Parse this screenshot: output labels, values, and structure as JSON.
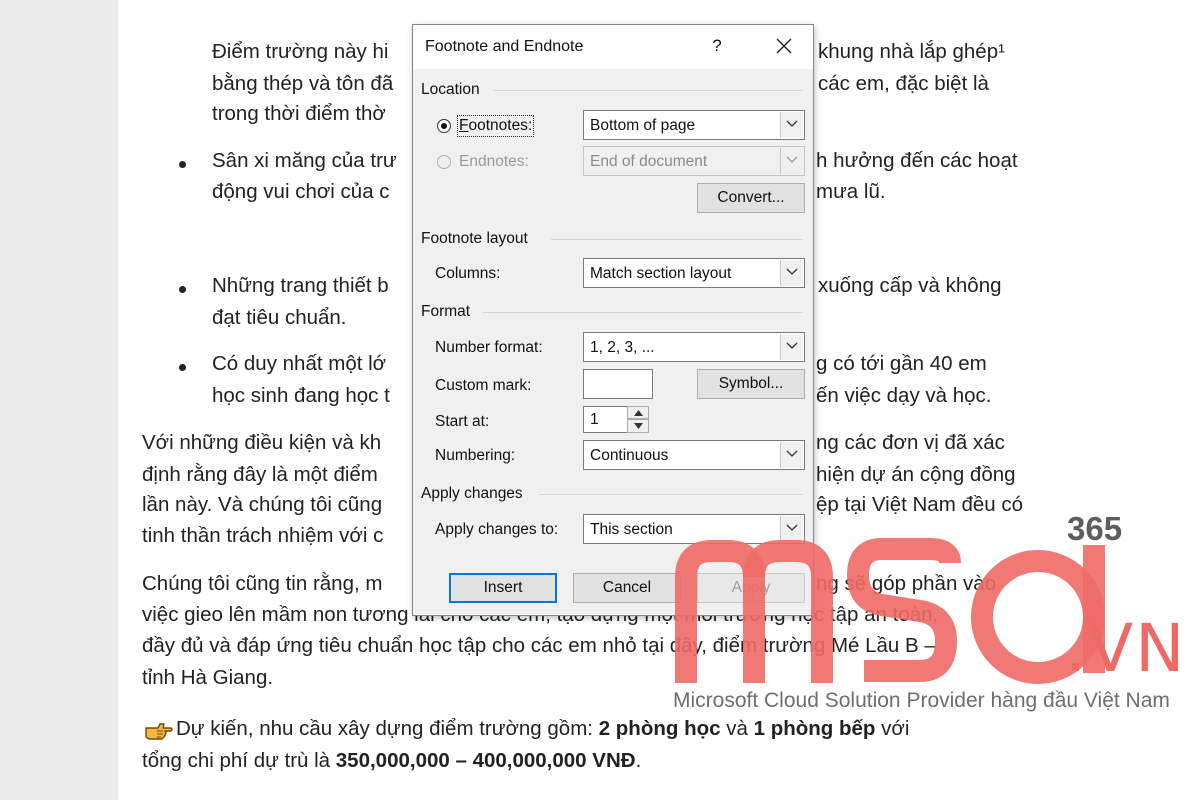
{
  "document": {
    "lines": [
      "Điểm trường này hi",
      "bằng thép và tôn đã",
      "trong thời điểm thờ",
      "Sân xi măng của trư",
      "động vui chơi của c",
      "Những trang thiết b",
      "đạt tiêu chuẩn.",
      "Có duy nhất một lớ",
      "học sinh đang học t",
      "Với những điều kiện và kh",
      "định rằng đây là một điểm",
      "lần này. Và chúng tôi cũng",
      "tinh thần trách nhiệm với c",
      "Chúng tôi cũng tin rằng, m",
      "việc gieo lên mầm non tương lai cho các em, tạo dựng một môi trường học tập an toàn,",
      "đầy đủ và đáp ứng tiêu chuẩn học tập cho các em nhỏ tại đây, điểm trường Mé Lầu B –",
      "tỉnh Hà Giang."
    ],
    "right_fragments": [
      "khung nhà lắp ghép¹",
      "các em, đặc biệt là",
      "h hưởng đến các hoạt",
      "mưa lũ.",
      "xuống cấp và không",
      "g có tới gần 40 em",
      "ến việc dạy và học.",
      "ng các đơn vị đã xác",
      "hiện dự án cộng đồng",
      "ệp tại Việt Nam đều có",
      "ng sẽ góp phần vào"
    ],
    "final_paragraph": {
      "part1": "Dự kiến, nhu cầu xây dựng điểm trường gồm: ",
      "bold1": "2 phòng học",
      "part2": " và ",
      "bold2": "1 phòng bếp",
      "part3": " với",
      "line2_part1": "tổng chi phí dự trù là ",
      "line2_bold": "350,000,000 – 400,000,000 VNĐ",
      "line2_end": "."
    }
  },
  "watermark": {
    "brand_letters": "msd",
    "suffix_365": "365",
    "suffix_vn": ".VN",
    "tagline": "Microsoft Cloud Solution Provider hàng đầu Việt Nam",
    "color": "#ee6a67"
  },
  "dialog": {
    "title": "Footnote and Endnote",
    "help": "?",
    "location": {
      "heading": "Location",
      "footnotes_label": "Footnotes:",
      "footnotes_value": "Bottom of page",
      "endnotes_label": "Endnotes:",
      "endnotes_value": "End of document",
      "convert_label": "Convert..."
    },
    "layout": {
      "heading": "Footnote layout",
      "columns_label": "Columns:",
      "columns_value": "Match section layout"
    },
    "format": {
      "heading": "Format",
      "number_format_label": "Number format:",
      "number_format_value": "1, 2, 3, ...",
      "custom_mark_label": "Custom mark:",
      "custom_mark_value": "",
      "symbol_label": "Symbol...",
      "start_at_label": "Start at:",
      "start_at_value": "1",
      "numbering_label": "Numbering:",
      "numbering_value": "Continuous"
    },
    "apply": {
      "heading": "Apply changes",
      "apply_to_label": "Apply changes to:",
      "apply_to_value": "This section"
    },
    "buttons": {
      "insert": "Insert",
      "cancel": "Cancel",
      "apply": "Apply"
    },
    "accent_color": "#0078d7"
  }
}
